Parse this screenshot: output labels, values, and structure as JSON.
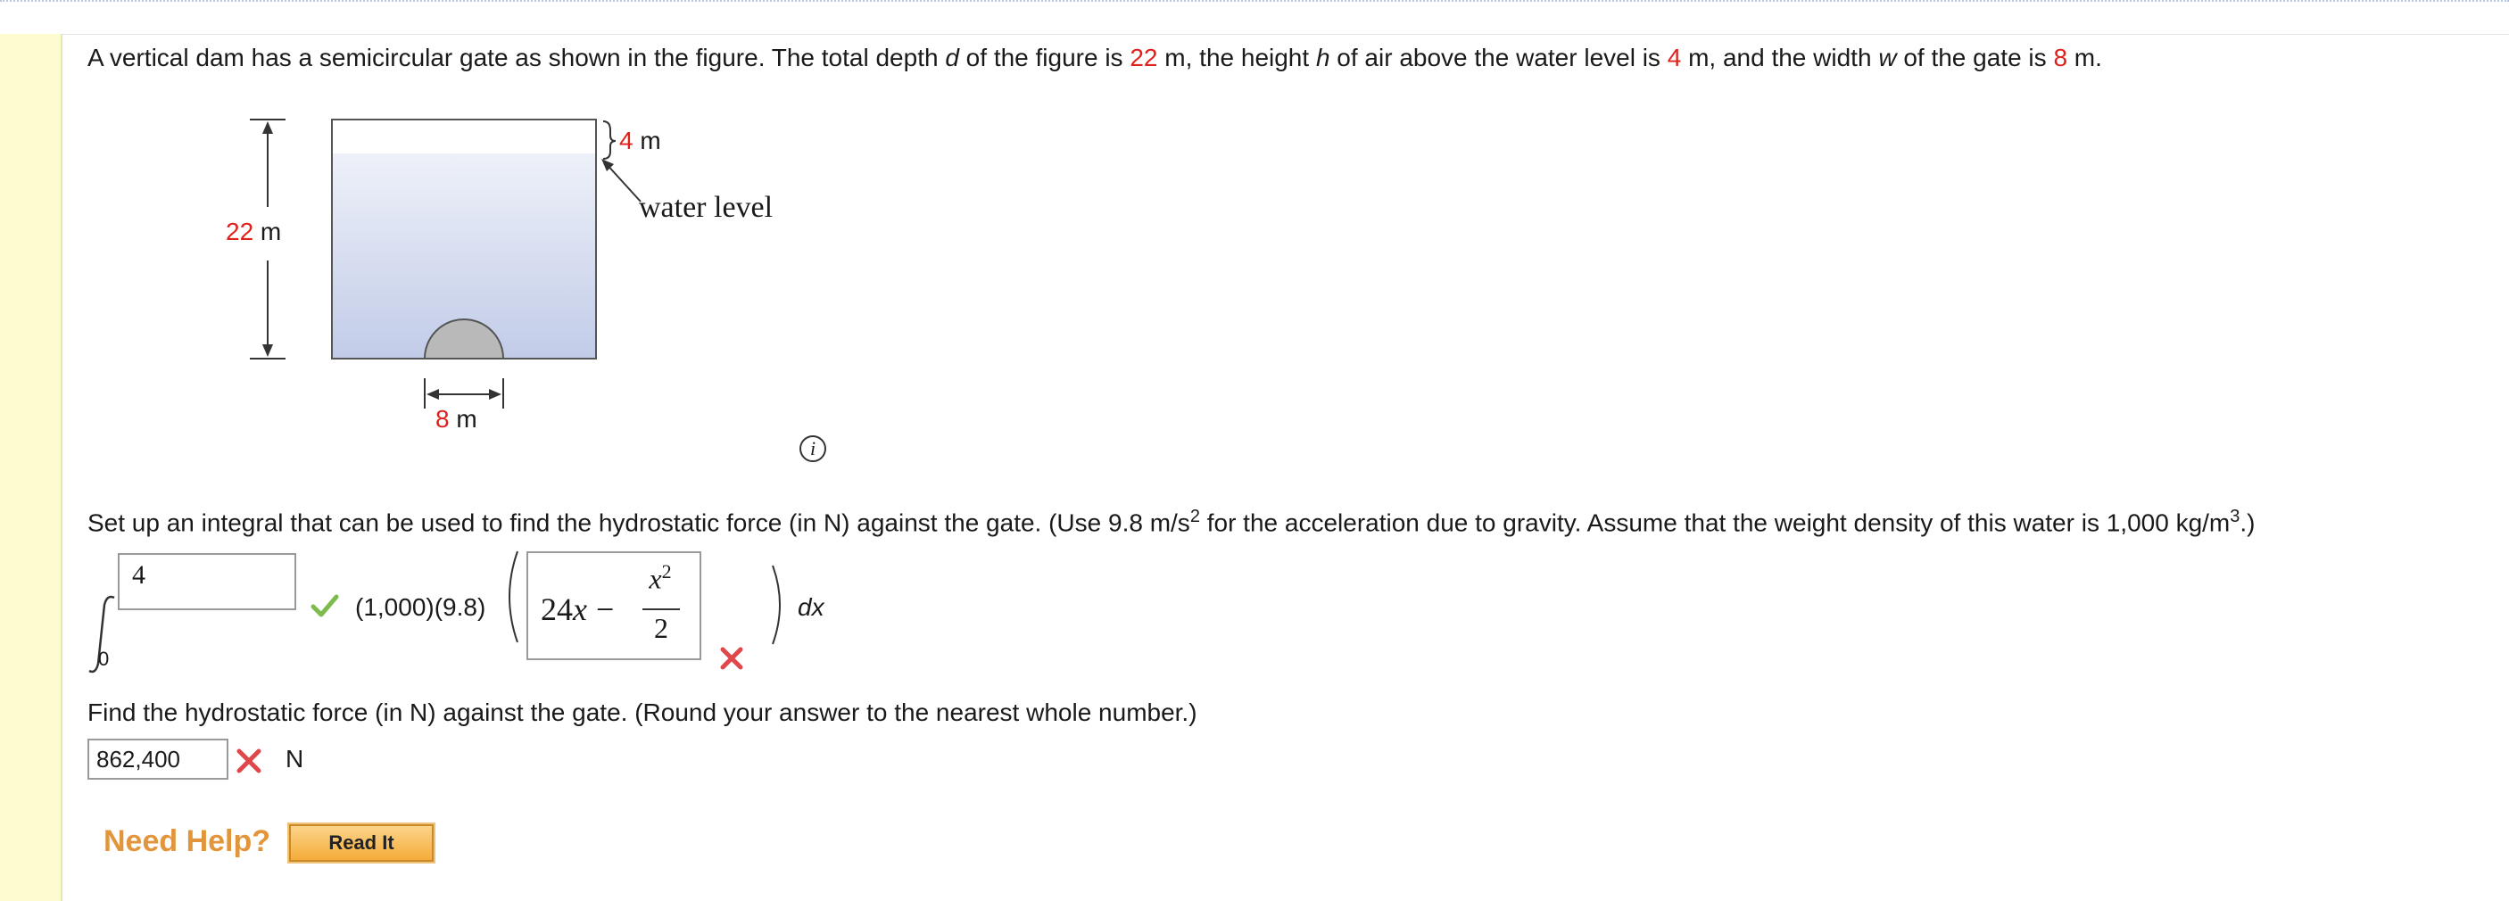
{
  "problem": {
    "intro_1": "A vertical dam has a semicircular gate as shown in the figure. The total depth ",
    "var_d": "d",
    "intro_2": " of the figure is ",
    "depth_value": "22",
    "intro_3": " m, the height ",
    "var_h": "h",
    "intro_4": " of air above the water level is ",
    "air_value": "4",
    "intro_5": " m, and the width ",
    "var_w": "w",
    "intro_6": " of the gate is ",
    "width_value": "8",
    "intro_7": " m."
  },
  "figure": {
    "depth_label_value": "22",
    "depth_label_unit": " m",
    "air_label_value": "4",
    "air_label_unit": " m",
    "water_level_label": "water level",
    "gate_width_value": "8",
    "gate_width_unit": " m",
    "info_icon": "i",
    "colors": {
      "water_top": "#eef1f9",
      "water_bottom": "#c2cce8",
      "gate": "#b9b9b9"
    }
  },
  "question1": {
    "text_a": "Set up an integral that can be used to find the hydrostatic force (in N) against the gate. (Use 9.8 m/s",
    "sup_a": "2",
    "text_b": " for the acceleration due to gravity. Assume that the weight density of this water is 1,000 kg/m",
    "sup_b": "3",
    "text_c": ".)",
    "upper_limit_value": "4",
    "lower_limit": "0",
    "coefficient": "(1,000)(9.8)",
    "integrand_term1": "24",
    "integrand_var": "x",
    "integrand_minus": "−",
    "integrand_num_var": "x",
    "integrand_num_exp": "2",
    "integrand_den": "2",
    "dx": "dx",
    "upper_limit_status": "correct",
    "integrand_status": "incorrect"
  },
  "question2": {
    "text": "Find the hydrostatic force (in N) against the gate. (Round your answer to the nearest whole number.)",
    "answer_value": "862,400",
    "unit": "N",
    "status": "incorrect"
  },
  "help": {
    "need_help_label": "Need Help?",
    "read_it_label": "Read It"
  }
}
